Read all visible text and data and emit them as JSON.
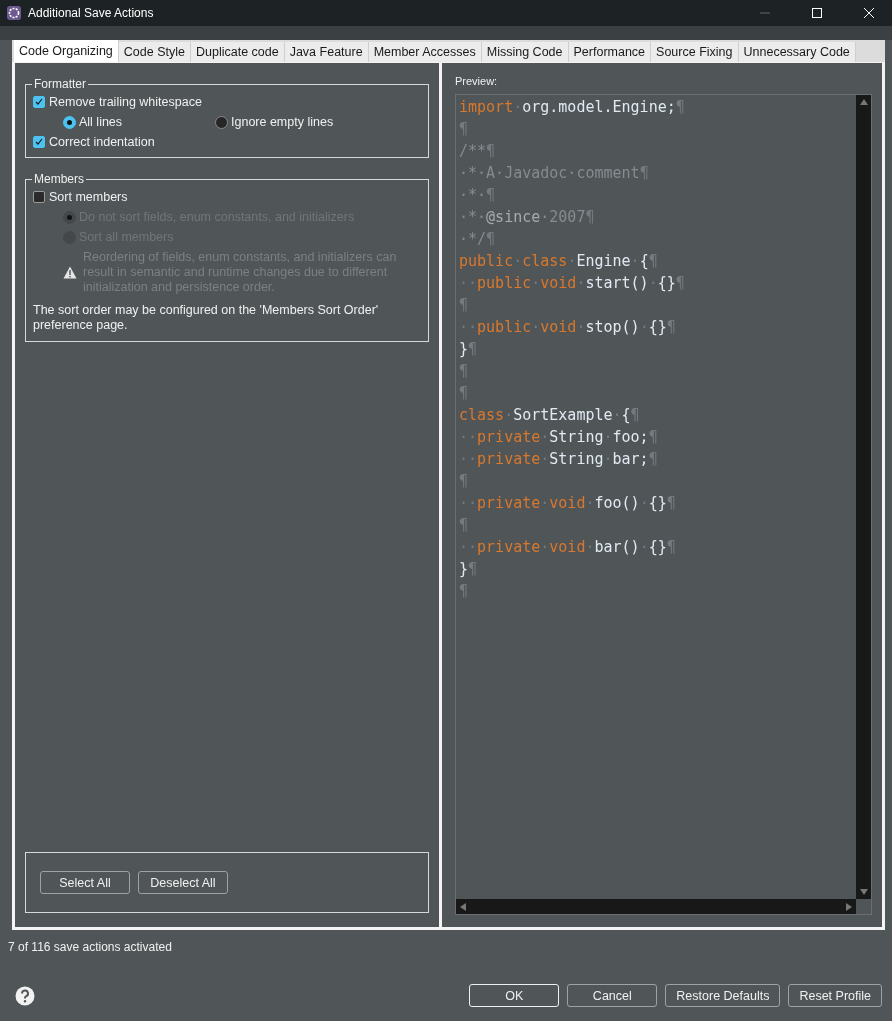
{
  "window": {
    "title": "Additional Save Actions"
  },
  "tabs": [
    {
      "label": "Code Organizing",
      "selected": true
    },
    {
      "label": "Code Style",
      "selected": false
    },
    {
      "label": "Duplicate code",
      "selected": false
    },
    {
      "label": "Java Feature",
      "selected": false
    },
    {
      "label": "Member Accesses",
      "selected": false
    },
    {
      "label": "Missing Code",
      "selected": false
    },
    {
      "label": "Performance",
      "selected": false
    },
    {
      "label": "Source Fixing",
      "selected": false
    },
    {
      "label": "Unnecessary Code",
      "selected": false
    }
  ],
  "formatter": {
    "title": "Formatter",
    "remove_trailing": {
      "label": "Remove trailing whitespace",
      "checked": true
    },
    "radios": [
      {
        "label": "All lines",
        "selected": true
      },
      {
        "label": "Ignore empty lines",
        "selected": false
      }
    ],
    "correct_indentation": {
      "label": "Correct indentation",
      "checked": true
    }
  },
  "members": {
    "title": "Members",
    "sort": {
      "label": "Sort members",
      "checked": false
    },
    "radios": [
      {
        "label": "Do not sort fields, enum constants, and initializers",
        "selected": true,
        "disabled": true
      },
      {
        "label": "Sort all members",
        "selected": false,
        "disabled": true
      }
    ],
    "warning": "Reordering of fields, enum constants, and initializers can result in semantic and runtime changes due to different initialization and persistence order.",
    "note": "The sort order may be configured on the 'Members Sort Order' preference page."
  },
  "selection_buttons": [
    "Select All",
    "Deselect All"
  ],
  "preview": {
    "label": "Preview:",
    "lines": [
      [
        {
          "kind": "keyword",
          "text": "import"
        },
        {
          "kind": "mark",
          "text": "·"
        },
        {
          "kind": "text",
          "text": "org.model.Engine;"
        },
        {
          "kind": "mark",
          "text": "¶"
        }
      ],
      [
        {
          "kind": "mark",
          "text": "¶"
        }
      ],
      [
        {
          "kind": "comment",
          "text": "/**"
        },
        {
          "kind": "mark",
          "text": "¶"
        }
      ],
      [
        {
          "kind": "comment",
          "text": "·*·A·Javadoc·comment"
        },
        {
          "kind": "mark",
          "text": "¶"
        }
      ],
      [
        {
          "kind": "comment",
          "text": "·*·"
        },
        {
          "kind": "mark",
          "text": "¶"
        }
      ],
      [
        {
          "kind": "comment",
          "text": "·*·"
        },
        {
          "kind": "tag",
          "text": "@since"
        },
        {
          "kind": "comment",
          "text": "·2007"
        },
        {
          "kind": "mark",
          "text": "¶"
        }
      ],
      [
        {
          "kind": "comment",
          "text": "·*/"
        },
        {
          "kind": "mark",
          "text": "¶"
        }
      ],
      [
        {
          "kind": "keyword",
          "text": "public"
        },
        {
          "kind": "mark",
          "text": "·"
        },
        {
          "kind": "keyword",
          "text": "class"
        },
        {
          "kind": "mark",
          "text": "·"
        },
        {
          "kind": "text",
          "text": "Engine"
        },
        {
          "kind": "mark",
          "text": "·"
        },
        {
          "kind": "text",
          "text": "{"
        },
        {
          "kind": "mark",
          "text": "¶"
        }
      ],
      [
        {
          "kind": "mark",
          "text": "··"
        },
        {
          "kind": "keyword",
          "text": "public"
        },
        {
          "kind": "mark",
          "text": "·"
        },
        {
          "kind": "keyword",
          "text": "void"
        },
        {
          "kind": "mark",
          "text": "·"
        },
        {
          "kind": "text",
          "text": "start()"
        },
        {
          "kind": "mark",
          "text": "·"
        },
        {
          "kind": "text",
          "text": "{}"
        },
        {
          "kind": "mark",
          "text": "¶"
        }
      ],
      [
        {
          "kind": "mark",
          "text": "¶"
        }
      ],
      [
        {
          "kind": "mark",
          "text": "··"
        },
        {
          "kind": "keyword",
          "text": "public"
        },
        {
          "kind": "mark",
          "text": "·"
        },
        {
          "kind": "keyword",
          "text": "void"
        },
        {
          "kind": "mark",
          "text": "·"
        },
        {
          "kind": "text",
          "text": "stop()"
        },
        {
          "kind": "mark",
          "text": "·"
        },
        {
          "kind": "text",
          "text": "{}"
        },
        {
          "kind": "mark",
          "text": "¶"
        }
      ],
      [
        {
          "kind": "text",
          "text": "}"
        },
        {
          "kind": "mark",
          "text": "¶"
        }
      ],
      [
        {
          "kind": "mark",
          "text": "¶"
        }
      ],
      [
        {
          "kind": "mark",
          "text": "¶"
        }
      ],
      [
        {
          "kind": "keyword",
          "text": "class"
        },
        {
          "kind": "mark",
          "text": "·"
        },
        {
          "kind": "text",
          "text": "SortExample"
        },
        {
          "kind": "mark",
          "text": "·"
        },
        {
          "kind": "text",
          "text": "{"
        },
        {
          "kind": "mark",
          "text": "¶"
        }
      ],
      [
        {
          "kind": "mark",
          "text": "··"
        },
        {
          "kind": "keyword",
          "text": "private"
        },
        {
          "kind": "mark",
          "text": "·"
        },
        {
          "kind": "text",
          "text": "String"
        },
        {
          "kind": "mark",
          "text": "·"
        },
        {
          "kind": "text",
          "text": "foo;"
        },
        {
          "kind": "mark",
          "text": "¶"
        }
      ],
      [
        {
          "kind": "mark",
          "text": "··"
        },
        {
          "kind": "keyword",
          "text": "private"
        },
        {
          "kind": "mark",
          "text": "·"
        },
        {
          "kind": "text",
          "text": "String"
        },
        {
          "kind": "mark",
          "text": "·"
        },
        {
          "kind": "text",
          "text": "bar;"
        },
        {
          "kind": "mark",
          "text": "¶"
        }
      ],
      [
        {
          "kind": "mark",
          "text": "¶"
        }
      ],
      [
        {
          "kind": "mark",
          "text": "··"
        },
        {
          "kind": "keyword",
          "text": "private"
        },
        {
          "kind": "mark",
          "text": "·"
        },
        {
          "kind": "keyword",
          "text": "void"
        },
        {
          "kind": "mark",
          "text": "·"
        },
        {
          "kind": "text",
          "text": "foo()"
        },
        {
          "kind": "mark",
          "text": "·"
        },
        {
          "kind": "text",
          "text": "{}"
        },
        {
          "kind": "mark",
          "text": "¶"
        }
      ],
      [
        {
          "kind": "mark",
          "text": "¶"
        }
      ],
      [
        {
          "kind": "mark",
          "text": "··"
        },
        {
          "kind": "keyword",
          "text": "private"
        },
        {
          "kind": "mark",
          "text": "·"
        },
        {
          "kind": "keyword",
          "text": "void"
        },
        {
          "kind": "mark",
          "text": "·"
        },
        {
          "kind": "text",
          "text": "bar()"
        },
        {
          "kind": "mark",
          "text": "·"
        },
        {
          "kind": "text",
          "text": "{}"
        },
        {
          "kind": "mark",
          "text": "¶"
        }
      ],
      [
        {
          "kind": "text",
          "text": "}"
        },
        {
          "kind": "mark",
          "text": "¶"
        }
      ],
      [
        {
          "kind": "mark",
          "text": "¶"
        }
      ]
    ]
  },
  "status": "7 of 116 save actions activated",
  "buttons": [
    {
      "label": "OK",
      "default": true
    },
    {
      "label": "Cancel",
      "default": false
    },
    {
      "label": "Restore Defaults",
      "default": false
    },
    {
      "label": "Reset Profile",
      "default": false
    }
  ]
}
